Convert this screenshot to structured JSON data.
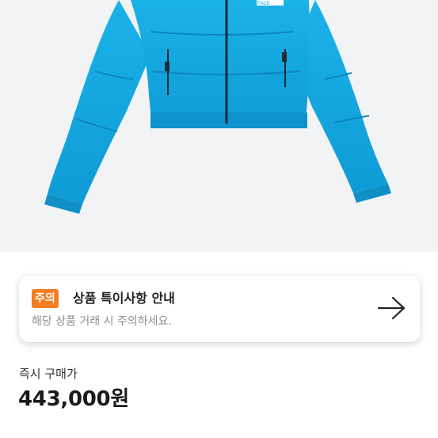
{
  "product": {
    "image_alt": "blue cropped puffer jacket",
    "logo_text": "FACE"
  },
  "notice": {
    "badge": "주의",
    "title": "상품 특이사항 안내",
    "subtitle": "해당 상품 거래 시 주의하세요.",
    "arrow_icon": "arrow-right-icon"
  },
  "price": {
    "label": "즉시 구매가",
    "value": "443,000원"
  },
  "colors": {
    "badge": "#f47d20",
    "jacket": "#14a6dd",
    "hero_bg": "#f2f3f5"
  }
}
